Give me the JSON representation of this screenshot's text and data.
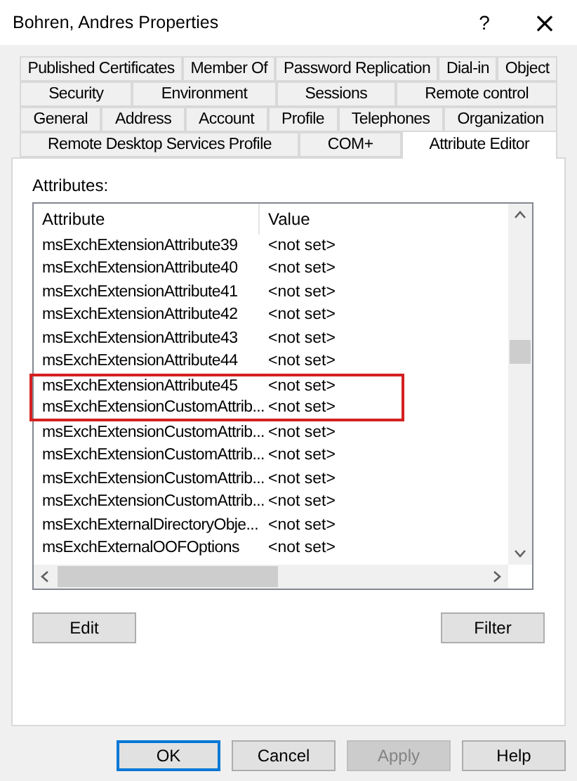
{
  "window": {
    "title": "Bohren, Andres Properties",
    "help": "?",
    "close": "×"
  },
  "tab_rows": [
    {
      "tabs": [
        {
          "label": "Published Certificates",
          "selected": false
        },
        {
          "label": "Member Of",
          "selected": false
        },
        {
          "label": "Password Replication",
          "selected": false
        },
        {
          "label": "Dial-in",
          "selected": false
        },
        {
          "label": "Object",
          "selected": false
        }
      ]
    },
    {
      "tabs": [
        {
          "label": "Security",
          "selected": false
        },
        {
          "label": "Environment",
          "selected": false
        },
        {
          "label": "Sessions",
          "selected": false
        },
        {
          "label": "Remote control",
          "selected": false
        }
      ]
    },
    {
      "tabs": [
        {
          "label": "General",
          "selected": false
        },
        {
          "label": "Address",
          "selected": false
        },
        {
          "label": "Account",
          "selected": false
        },
        {
          "label": "Profile",
          "selected": false
        },
        {
          "label": "Telephones",
          "selected": false
        },
        {
          "label": "Organization",
          "selected": false
        }
      ]
    },
    {
      "tabs": [
        {
          "label": "Remote Desktop Services Profile",
          "selected": false
        },
        {
          "label": "COM+",
          "selected": false
        },
        {
          "label": "Attribute Editor",
          "selected": true
        }
      ]
    }
  ],
  "attributes": {
    "label": "Attributes:",
    "columns": [
      "Attribute",
      "Value"
    ],
    "rows": [
      {
        "attribute": "msExchExtensionAttribute39",
        "value": "<not set>",
        "highlighted": false
      },
      {
        "attribute": "msExchExtensionAttribute40",
        "value": "<not set>",
        "highlighted": false
      },
      {
        "attribute": "msExchExtensionAttribute41",
        "value": "<not set>",
        "highlighted": false
      },
      {
        "attribute": "msExchExtensionAttribute42",
        "value": "<not set>",
        "highlighted": false
      },
      {
        "attribute": "msExchExtensionAttribute43",
        "value": "<not set>",
        "highlighted": false
      },
      {
        "attribute": "msExchExtensionAttribute44",
        "value": "<not set>",
        "highlighted": false
      },
      {
        "attribute": "msExchExtensionAttribute45",
        "value": "<not set>",
        "highlighted": true
      },
      {
        "attribute": "msExchExtensionCustomAttrib...",
        "value": "<not set>",
        "highlighted": true
      },
      {
        "attribute": "msExchExtensionCustomAttrib...",
        "value": "<not set>",
        "highlighted": false
      },
      {
        "attribute": "msExchExtensionCustomAttrib...",
        "value": "<not set>",
        "highlighted": false
      },
      {
        "attribute": "msExchExtensionCustomAttrib...",
        "value": "<not set>",
        "highlighted": false
      },
      {
        "attribute": "msExchExtensionCustomAttrib...",
        "value": "<not set>",
        "highlighted": false
      },
      {
        "attribute": "msExchExternalDirectoryObje...",
        "value": "<not set>",
        "highlighted": false
      },
      {
        "attribute": "msExchExternalOOFOptions",
        "value": "<not set>",
        "highlighted": false
      }
    ]
  },
  "panel_buttons": [
    {
      "label": "Edit",
      "disabled": false
    },
    {
      "label": "Filter",
      "disabled": false
    }
  ],
  "dialog_buttons": [
    {
      "label": "OK",
      "disabled": false,
      "default": true
    },
    {
      "label": "Cancel",
      "disabled": false,
      "default": false
    },
    {
      "label": "Apply",
      "disabled": true,
      "default": false
    },
    {
      "label": "Help",
      "disabled": false,
      "default": false
    }
  ]
}
